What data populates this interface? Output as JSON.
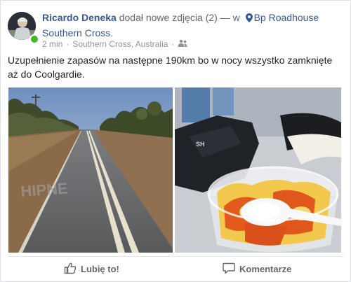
{
  "post": {
    "author": "Ricardo Deneka",
    "action": "dodał nowe zdjęcia (2) — w",
    "place_line1": "Bp Roadhouse",
    "place_line2": "Southern Cross.",
    "time": "2 min",
    "location": "Southern Cross, Australia",
    "text": "Uzupełnienie zapasów na następne 190km bo w nocy wszystko zamknięte aż do Coolgardie."
  },
  "icons": {
    "avatar": "profile-photo",
    "place": "location-pin-icon",
    "audience": "friends-icon",
    "like": "thumbs-up-icon",
    "comment": "speech-bubble-icon"
  },
  "actions": {
    "like_label": "Lubię to!",
    "comment_label": "Komentarze"
  },
  "colors": {
    "link": "#365899",
    "secondary": "#90949c",
    "online": "#42b72a"
  }
}
